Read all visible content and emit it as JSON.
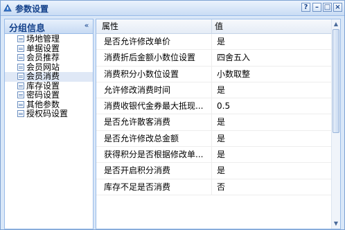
{
  "window": {
    "title": "参数设置",
    "buttons": [
      "?",
      "–",
      "□",
      "×"
    ]
  },
  "sidebar": {
    "title": "分组信息",
    "collapse_glyph": "«",
    "items": [
      {
        "label": "场地管理"
      },
      {
        "label": "单据设置"
      },
      {
        "label": "会员推荐"
      },
      {
        "label": "会员网站"
      },
      {
        "label": "会员消费"
      },
      {
        "label": "库存设置"
      },
      {
        "label": "密码设置"
      },
      {
        "label": "其他参数"
      },
      {
        "label": "授权码设置"
      }
    ],
    "selected_index": 4
  },
  "grid": {
    "headers": {
      "property": "属性",
      "value": "值"
    },
    "rows": [
      {
        "property": "是否允许修改单价",
        "value": "是"
      },
      {
        "property": "消费折后金额小数位设置",
        "value": "四舍五入"
      },
      {
        "property": "消费积分小数位设置",
        "value": "小数取整"
      },
      {
        "property": "允许修改消费时间",
        "value": "是"
      },
      {
        "property": "消费收银代金券最大抵现...",
        "value": "0.5"
      },
      {
        "property": "是否允许散客消费",
        "value": "是"
      },
      {
        "property": "是否允许修改总金额",
        "value": "是"
      },
      {
        "property": "获得积分是否根据修改单...",
        "value": "是"
      },
      {
        "property": "是否开启积分消费",
        "value": "是"
      },
      {
        "property": "库存不足是否消费",
        "value": "否"
      }
    ]
  }
}
